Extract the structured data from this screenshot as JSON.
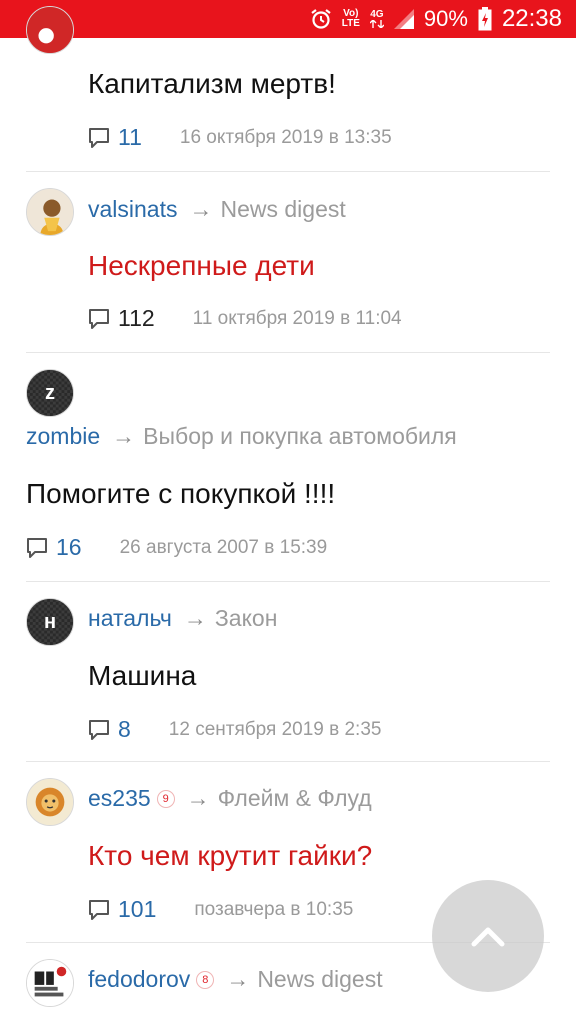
{
  "status_bar": {
    "volte_top": "Vo)",
    "volte_bottom": "LTE",
    "network": "4G",
    "battery": "90%",
    "time": "22:38"
  },
  "posts": [
    {
      "title": "Капитализм мертв!",
      "title_color": "#111111",
      "comments": "11",
      "date": "16 октября 2019 в 13:35"
    },
    {
      "author": "valsinats",
      "hub": "News digest",
      "title": "Нескрепные дети",
      "title_color": "#cf1a1a",
      "comments": "112",
      "date": "11 октября 2019 в 11:04"
    },
    {
      "avatar_letter": "z",
      "author": "zombie",
      "hub": "Выбор и покупка автомобиля",
      "title": "Помогите с покупкой !!!!",
      "title_color": "#111111",
      "comments": "16",
      "date": "26 августа 2007 в 15:39"
    },
    {
      "avatar_letter": "н",
      "author": "натальч",
      "hub": "Закон",
      "title": "Машина",
      "title_color": "#111111",
      "comments": "8",
      "date": "12 сентября 2019 в 2:35"
    },
    {
      "author": "es235",
      "badge": "9",
      "hub": "Флейм & Флуд",
      "title": "Кто чем крутит гайки?",
      "title_color": "#cf1a1a",
      "comments": "101",
      "date": "позавчера в 10:35"
    },
    {
      "author": "fedodorov",
      "badge": "8",
      "hub": "News digest"
    }
  ],
  "arrow_glyph": "→",
  "icons": {
    "comment": "comment-icon",
    "scroll_top": "chevron-up-icon"
  },
  "colors": {
    "status_bar": "#e8141c",
    "author_link": "#2a6aa8",
    "hub": "#9b9b9b",
    "red_title": "#cf1a1a"
  }
}
